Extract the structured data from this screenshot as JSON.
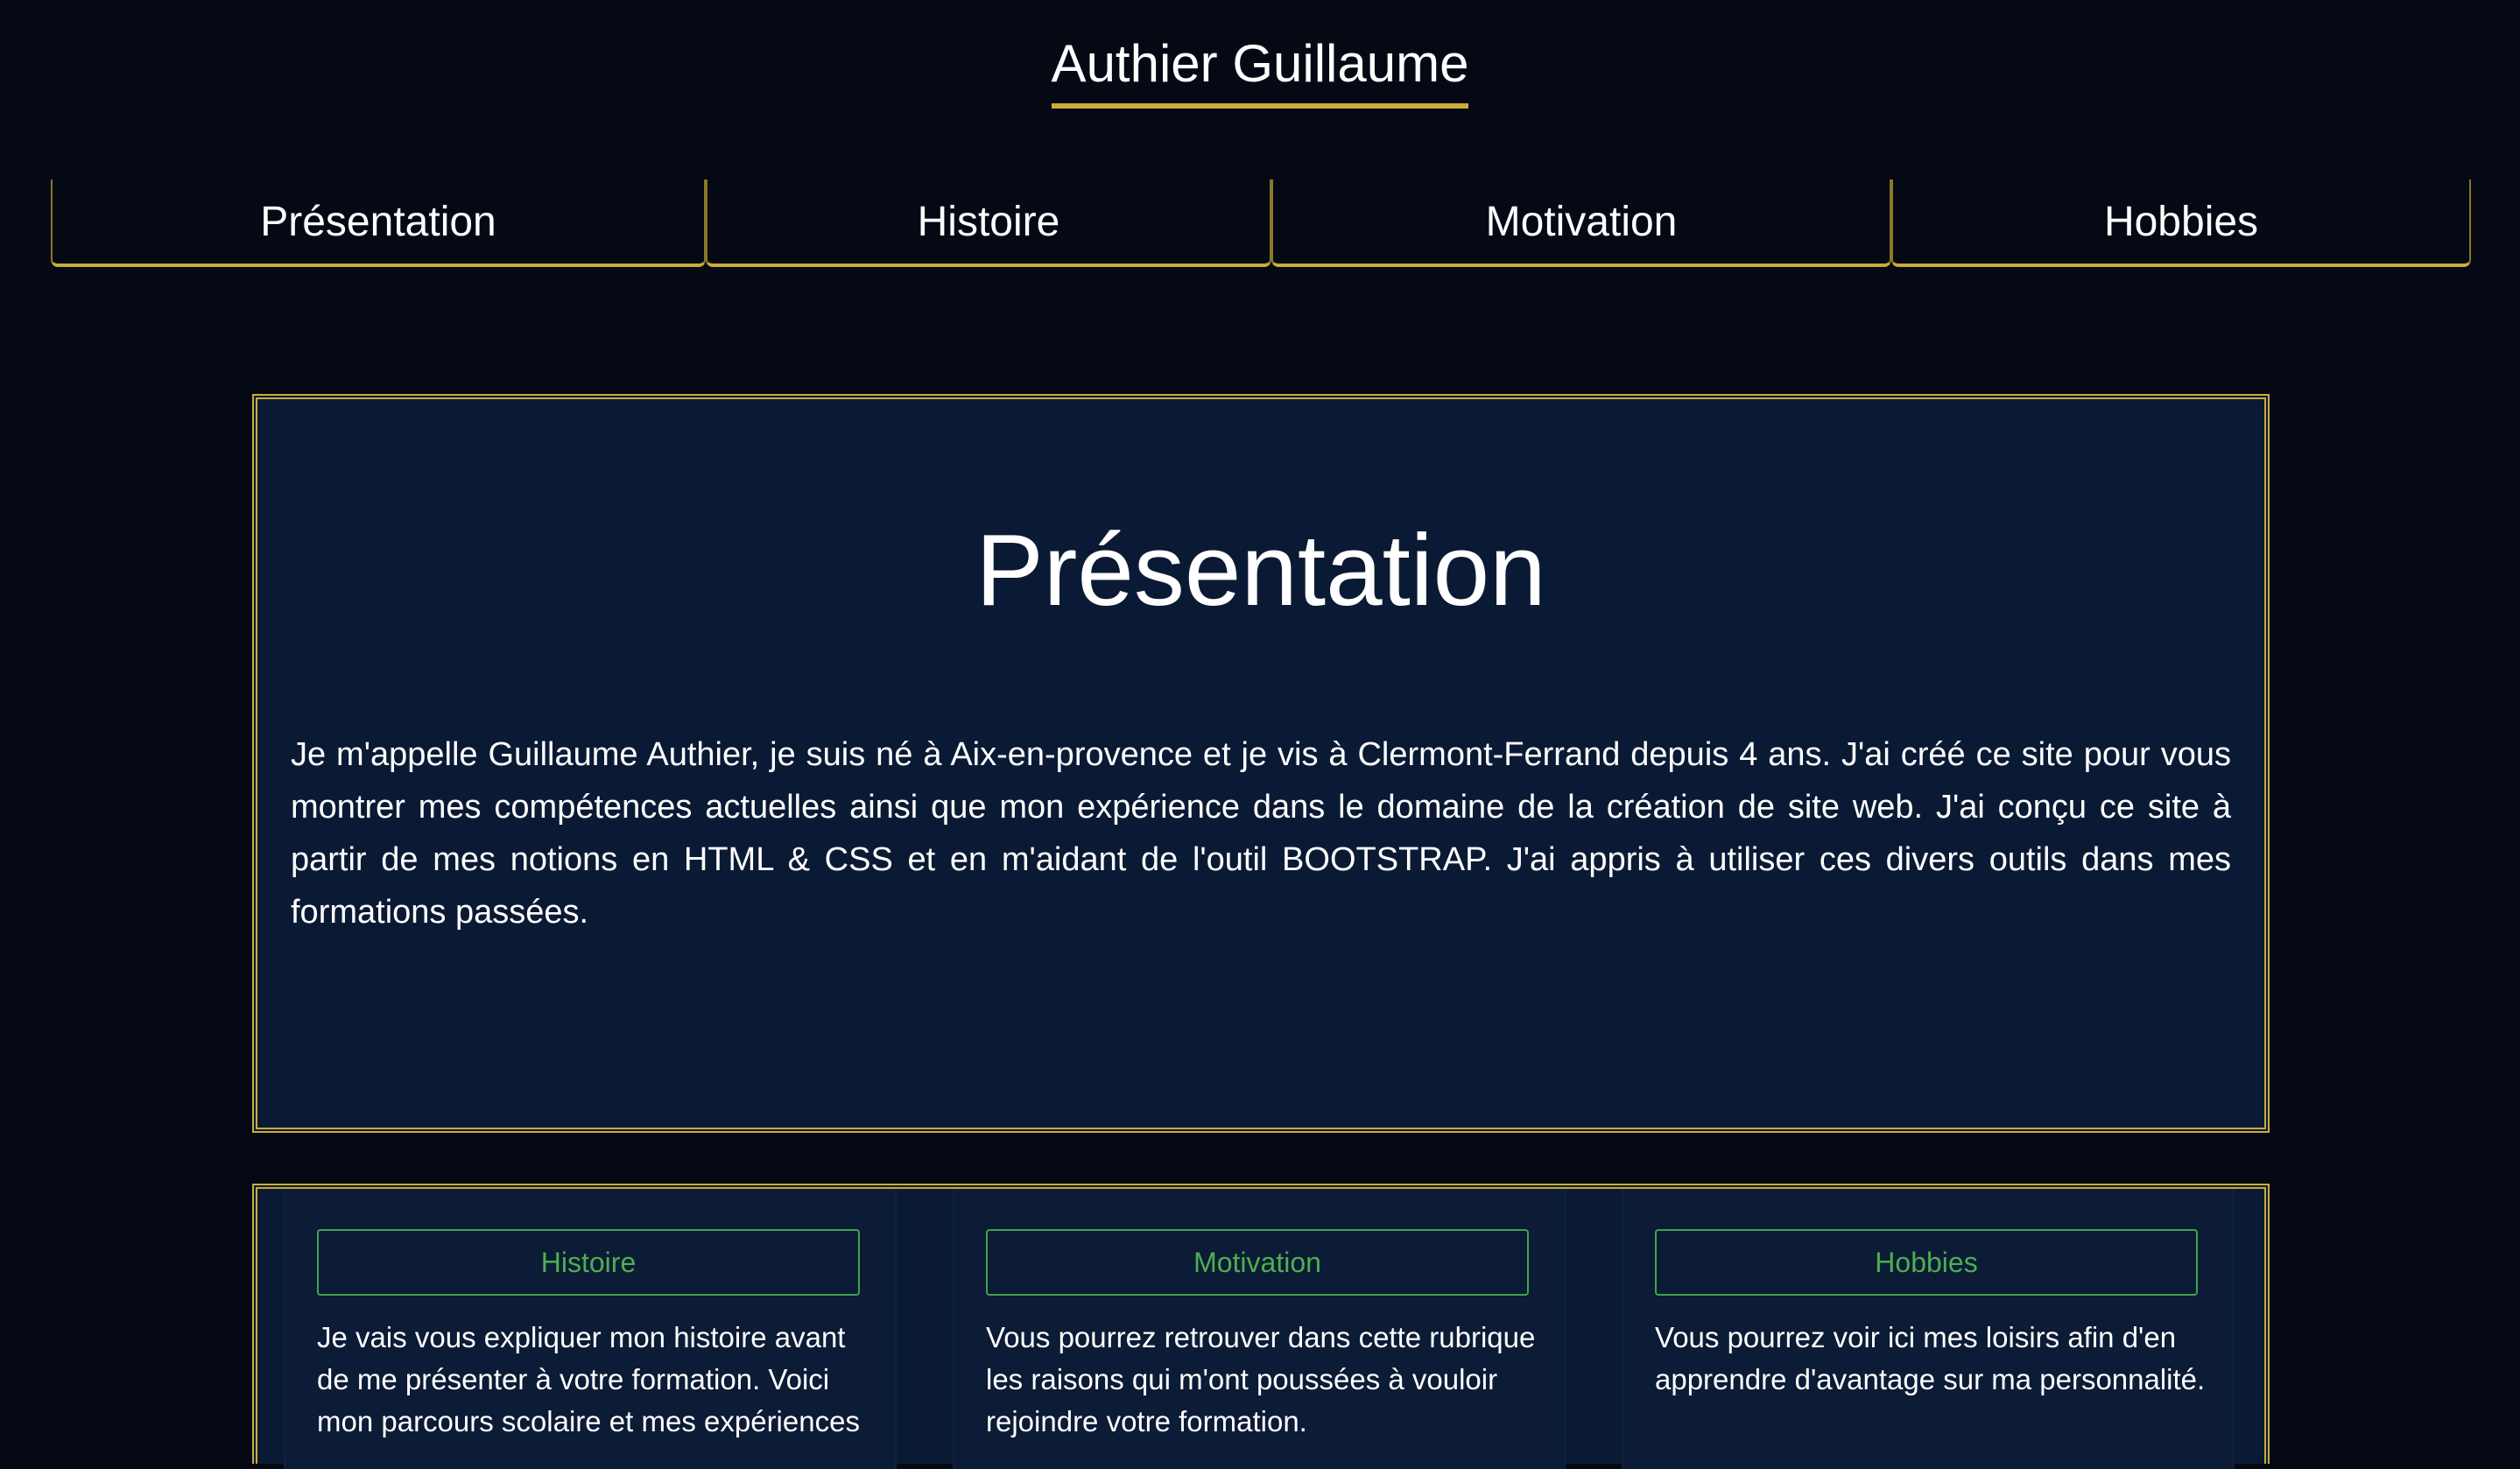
{
  "header": {
    "title": "Authier Guillaume"
  },
  "nav": {
    "items": [
      {
        "label": "Présentation"
      },
      {
        "label": "Histoire"
      },
      {
        "label": "Motivation"
      },
      {
        "label": "Hobbies"
      }
    ]
  },
  "presentation": {
    "heading": "Présentation",
    "text": "Je m'appelle Guillaume Authier, je suis né à Aix-en-provence et je vis à Clermont-Ferrand depuis 4 ans. J'ai créé ce site pour vous montrer mes compétences actuelles ainsi que mon expérience dans le domaine de la création de site web. J'ai conçu ce site à partir de mes notions en HTML & CSS et en m'aidant de l'outil BOOTSTRAP. J'ai appris à utiliser ces divers outils dans mes formations passées."
  },
  "cards": [
    {
      "button_label": "Histoire",
      "text": "Je vais vous expliquer mon histoire avant de me présenter à votre formation. Voici mon parcours scolaire et mes expériences"
    },
    {
      "button_label": "Motivation",
      "text": "Vous pourrez retrouver dans cette rubrique les raisons qui m'ont poussées à vouloir rejoindre votre formation."
    },
    {
      "button_label": "Hobbies",
      "text": "Vous pourrez voir ici mes loisirs afin d'en apprendre d'avantage sur ma personnalité."
    }
  ],
  "colors": {
    "background": "#040913",
    "panel": "#0b1a34",
    "accent_gold": "#c9ac3a",
    "button_green": "#4caf50"
  }
}
